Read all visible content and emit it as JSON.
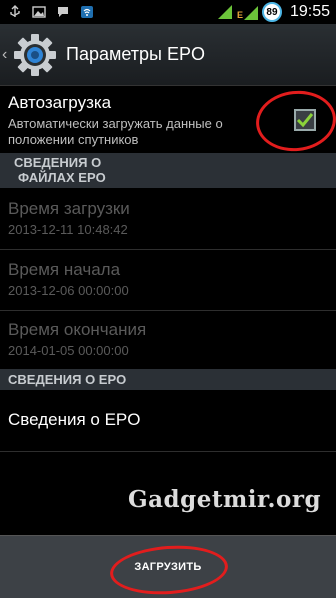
{
  "status_bar": {
    "time": "19:55",
    "battery": "89",
    "network_type": "E",
    "icons": [
      "usb-icon",
      "image-icon",
      "chat-icon",
      "wifi-icon",
      "mobile-data-icon",
      "signal-icon",
      "battery-icon"
    ]
  },
  "action_bar": {
    "title": "Параметры EPO",
    "icon": "settings-gear-icon"
  },
  "autoload": {
    "title": "Автозагрузка",
    "summary_line1": "Автоматически загружать данные о",
    "summary_line2": "положении спутников",
    "checked": true
  },
  "section_files": {
    "line1": "СВЕДЕНИЯ О",
    "line2": "ФАЙЛАХ EPO"
  },
  "download_time": {
    "title": "Время загрузки",
    "value": "2013-12-11 10:48:42"
  },
  "start_time": {
    "title": "Время начала",
    "value": "2013-12-06 00:00:00"
  },
  "end_time": {
    "title": "Время окончания",
    "value": "2014-01-05 00:00:00"
  },
  "section_info": {
    "label": "СВЕДЕНИЯ О EPO"
  },
  "info_item": {
    "title": "Сведения о EPO"
  },
  "watermark": "Gadgetmir.org",
  "bottom": {
    "download_label": "ЗАГРУЗИТЬ"
  },
  "colors": {
    "accent": "#4db6e6",
    "annotation": "#e21d1d",
    "check": "#8bd33a"
  }
}
